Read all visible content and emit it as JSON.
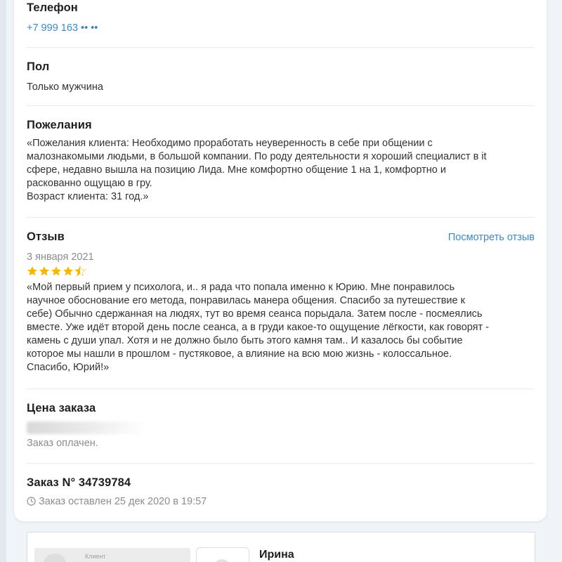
{
  "phone": {
    "heading": "Телефон",
    "value": "+7 999 163 •• ••"
  },
  "gender": {
    "heading": "Пол",
    "value": "Только мужчина"
  },
  "wishes": {
    "heading": "Пожелания",
    "lines": [
      "«Пожелания клиента: Необходимо проработать неуверенность в себе при общении с",
      "малознакомыми людьми, в большой компании. По роду деятельности я хороший специалист в it",
      "сфере, недавно вышла на позицию Лида. Мне комфортно общение 1 на 1, комфортно и",
      "раскованно ощущаю в гру.",
      "Возраст клиента: 31 год.»"
    ]
  },
  "review": {
    "heading": "Отзыв",
    "view_link": "Посмотреть отзыв",
    "date": "3 января 2021",
    "rating": 4.5,
    "rating_max": 5,
    "star_color": "#f5b800",
    "lines": [
      "«Мой первый прием у психолога, и.. я рада что попала именно к Юрию. Мне понравилось",
      "научное обоснование его метода, понравилась манера общения. Спасибо за путешествие к",
      "себе) Обычно сдержанная на людях, тут во время сеанса порыдала. Затем после - посмеялись",
      "вместе. Уже идёт второй день после сеанса, а в груди какое-то ощущение лёгкости, как говорят -",
      "камень с души упал. Хотя и не должно было быть этого камня там.. И казалось бы событие",
      "которое мы нашли в прошлом - пустяковое, а влияние на всю мою жизнь - колоссальное.",
      "Спасибо, Юрий!»"
    ]
  },
  "price": {
    "heading": "Цена заказа",
    "status": "Заказ оплачен."
  },
  "order": {
    "heading": "Заказ N° 34739784",
    "placed": "Заказ оставлен 25 дек 2020 в 19:57",
    "icon": "clock-icon"
  },
  "bottom": {
    "client_label": "Клиент",
    "client_name": "Ирина"
  },
  "colors": {
    "link": "#3b87c4",
    "star": "#f5b800",
    "background": "#f0f3f7"
  }
}
